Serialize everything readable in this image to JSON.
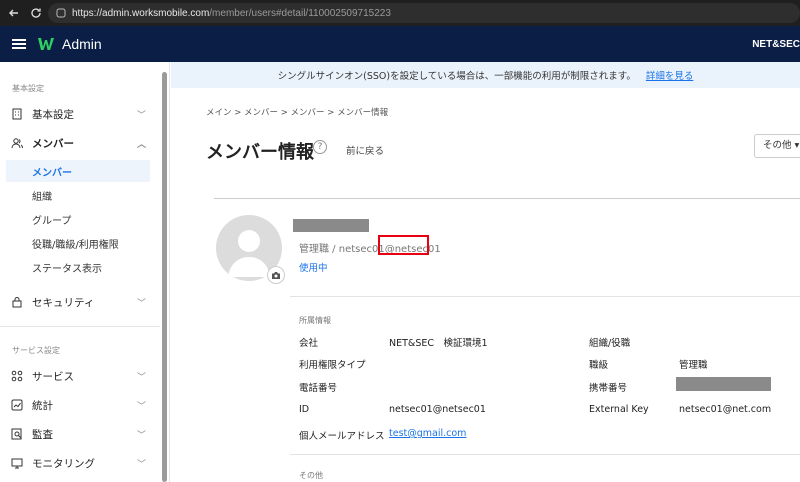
{
  "browser": {
    "url_host": "https://admin.worksmobile.com",
    "url_path": "/member/users#detail/110002509715223"
  },
  "header": {
    "app_title": "Admin",
    "org_name": "NET&SEC"
  },
  "sidebar": {
    "section_basic": "基本設定",
    "basic_settings": "基本設定",
    "members": "メンバー",
    "sub_items": [
      "メンバー",
      "組織",
      "グループ",
      "役職/職級/利用権限",
      "ステータス表示"
    ],
    "security": "セキュリティ",
    "section_service": "サービス設定",
    "service": "サービス",
    "stats": "統計",
    "audit": "監査",
    "monitoring": "モニタリング"
  },
  "banner": {
    "text": "シングルサインオン(SSO)を設定している場合は、一部機能の利用が制限されます。",
    "link": "詳細を見る"
  },
  "breadcrumb": "メイン  >  メンバー  >  メンバー  >  メンバー情報",
  "page": {
    "title": "メンバー情報",
    "help": "?",
    "back": "前に戻る",
    "more": "その他 ▾"
  },
  "profile": {
    "role_line": "管理職 / netsec01@netsec01",
    "status": "使用中"
  },
  "affiliation": {
    "section": "所属情報",
    "company_label": "会社",
    "company_value": "NET&SEC　検証環境1",
    "org_label": "組織/役職",
    "permission_type_label": "利用権限タイプ",
    "grade_label": "職級",
    "grade_value": "管理職",
    "phone_label": "電話番号",
    "mobile_label": "携帯番号",
    "id_label": "ID",
    "id_value": "netsec01@netsec01",
    "external_key_label": "External Key",
    "external_key_value": "netsec01@net.com",
    "personal_email_label": "個人メールアドレス",
    "personal_email_value": "test@gmail.com"
  },
  "other_section": "その他",
  "colors": {
    "header_bg": "#0b1f46",
    "accent": "#1a73e8",
    "highlight": "#e60012",
    "banner_bg": "#eaf3fb"
  }
}
